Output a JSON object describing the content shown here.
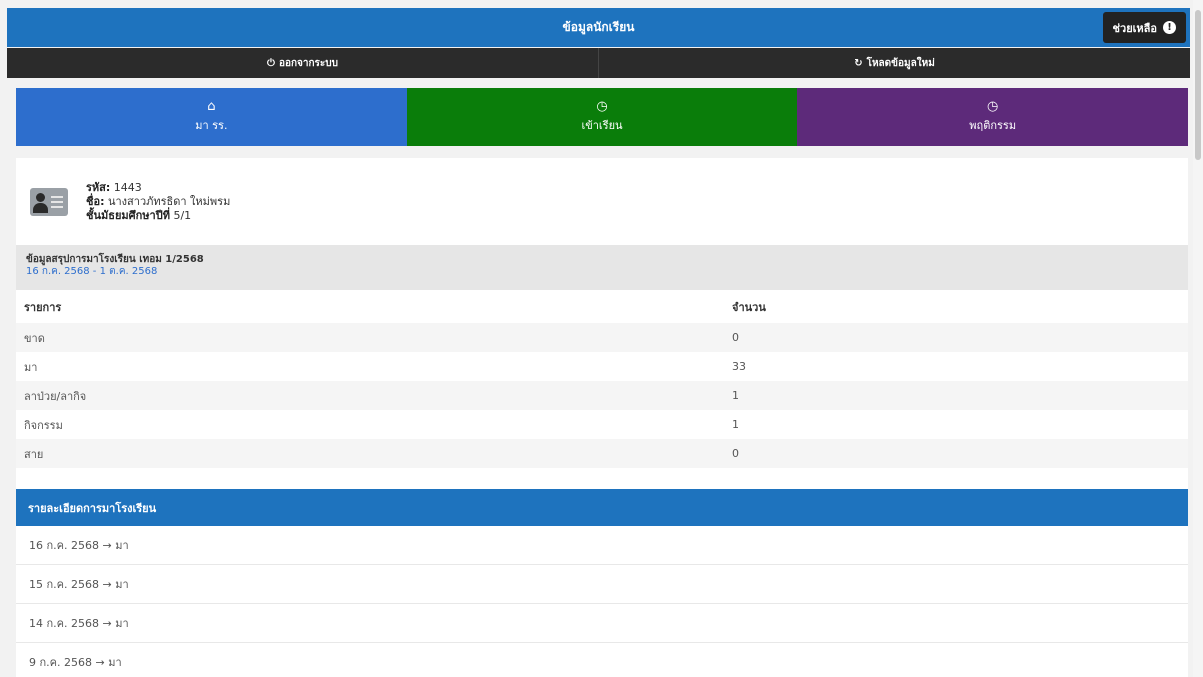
{
  "header": {
    "title": "ข้อมูลนักเรียน",
    "help_label": "ช่วยเหลือ",
    "help_icon": "info-circle-icon"
  },
  "subbar": {
    "left_label": "ออกจากระบบ",
    "left_icon": "power-icon",
    "right_label": "โหลดข้อมูลใหม่",
    "right_icon": "refresh-icon"
  },
  "tabs": [
    {
      "label": "มา รร.",
      "icon": "home-icon",
      "color": "#2d6ecd"
    },
    {
      "label": "เข้าเรียน",
      "icon": "clock-icon",
      "color": "#0a7d0a"
    },
    {
      "label": "พฤติกรรม",
      "icon": "clock-icon",
      "color": "#5d2a7a"
    }
  ],
  "student": {
    "id_label": "รหัส:",
    "id_value": "1443",
    "name_label": "ชื่อ:",
    "name_value": "นางสาวภัทรธิดา ใหม่พรม",
    "class_label": "ชั้นมัธยมศึกษาปีที่",
    "class_value": "5/1"
  },
  "summary": {
    "title": "ข้อมูลสรุปการมาโรงเรียน เทอม 1/2568",
    "date_range": "16 ก.ค. 2568 - 1 ต.ค. 2568",
    "col_item": "รายการ",
    "col_count": "จำนวน",
    "rows": [
      {
        "label": "ขาด",
        "value": "0"
      },
      {
        "label": "มา",
        "value": "33"
      },
      {
        "label": "ลาป่วย/ลากิจ",
        "value": "1"
      },
      {
        "label": "กิจกรรม",
        "value": "1"
      },
      {
        "label": "สาย",
        "value": "0"
      }
    ]
  },
  "details": {
    "title": "รายละเอียดการมาโรงเรียน",
    "items": [
      "16 ก.ค. 2568 → มา",
      "15 ก.ค. 2568 → มา",
      "14 ก.ค. 2568 → มา",
      "9 ก.ค. 2568 → มา"
    ]
  }
}
